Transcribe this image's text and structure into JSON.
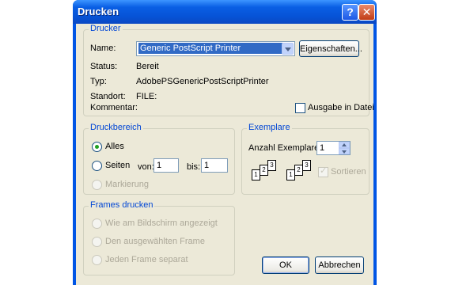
{
  "window": {
    "title": "Drucken"
  },
  "printer_group": {
    "legend": "Drucker",
    "name_label": "Name:",
    "printer_selected": "Generic PostScript Printer",
    "properties_button": "Eigenschaften...",
    "status_label": "Status:",
    "status_value": "Bereit",
    "type_label": "Typ:",
    "type_value": "AdobePSGenericPostScriptPrinter",
    "location_label": "Standort:",
    "location_value": "FILE:",
    "comment_label": "Kommentar:",
    "print_to_file_label": "Ausgabe in Datei",
    "print_to_file_checked": false
  },
  "range_group": {
    "legend": "Druckbereich",
    "all_label": "Alles",
    "pages_label": "Seiten",
    "from_label": "von:",
    "from_value": "1",
    "to_label": "bis:",
    "to_value": "1",
    "selection_label": "Markierung",
    "selected": "all"
  },
  "copies_group": {
    "legend": "Exemplare",
    "count_label": "Anzahl Exemplare:",
    "count_value": "1",
    "collate_label": "Sortieren",
    "collate_checked": true,
    "collate_page_numbers": [
      "1",
      "2",
      "3"
    ]
  },
  "frames_group": {
    "legend": "Frames drucken",
    "option1": "Wie am Bildschirm angezeigt",
    "option2": "Den ausgewählten Frame",
    "option3": "Jeden Frame separat"
  },
  "buttons": {
    "ok": "OK",
    "cancel": "Abbrechen"
  }
}
